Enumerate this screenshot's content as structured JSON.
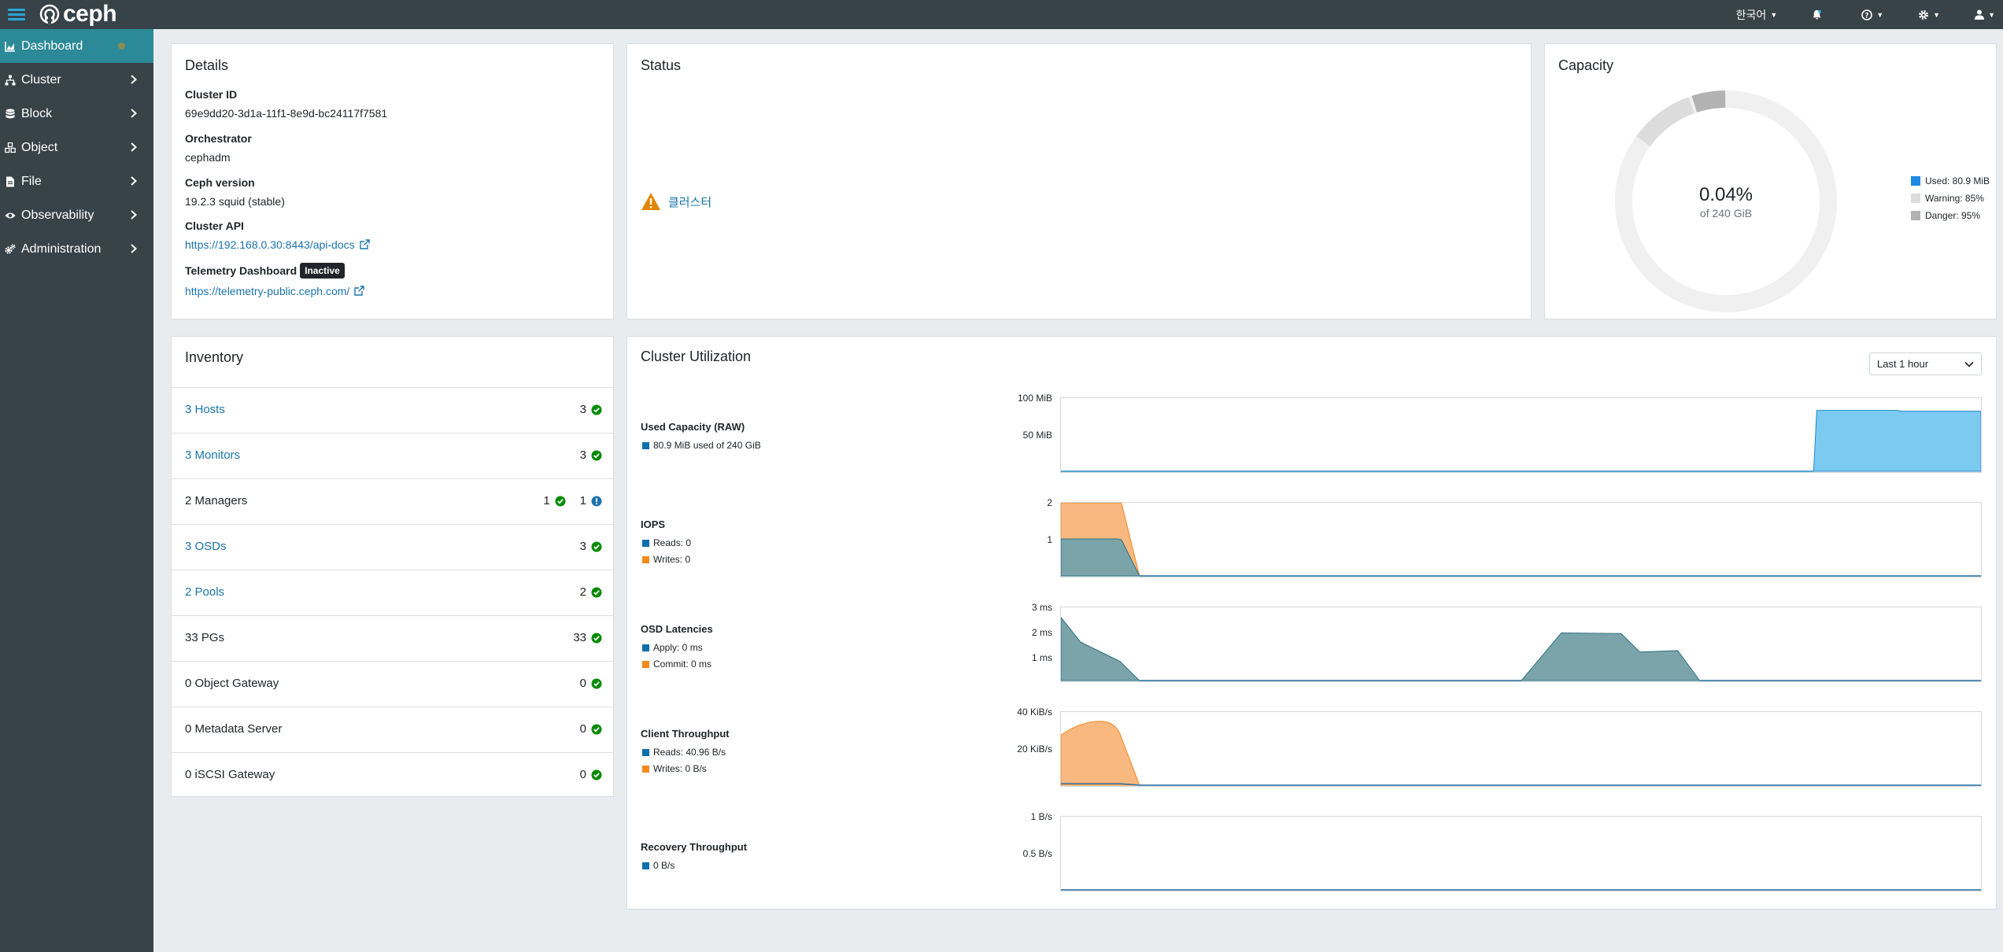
{
  "navbar": {
    "brand": "ceph",
    "language": "한국어",
    "icons": [
      "bell-icon",
      "help-icon",
      "gear-icon",
      "user-icon"
    ]
  },
  "sidebar": {
    "items": [
      {
        "label": "Dashboard",
        "icon": "chart-area-icon",
        "active": true
      },
      {
        "label": "Cluster",
        "icon": "sitemap-icon"
      },
      {
        "label": "Block",
        "icon": "database-icon"
      },
      {
        "label": "Object",
        "icon": "cubes-icon"
      },
      {
        "label": "File",
        "icon": "file-icon"
      },
      {
        "label": "Observability",
        "icon": "eye-icon"
      },
      {
        "label": "Administration",
        "icon": "cogs-icon"
      }
    ]
  },
  "details": {
    "title": "Details",
    "cluster_id_label": "Cluster ID",
    "cluster_id": "69e9dd20-3d1a-11f1-8e9d-bc24117f7581",
    "orchestrator_label": "Orchestrator",
    "orchestrator": "cephadm",
    "version_label": "Ceph version",
    "version": "19.2.3 squid (stable)",
    "api_label": "Cluster API",
    "api_link": "https://192.168.0.30:8443/api-docs",
    "telemetry_label": "Telemetry Dashboard",
    "telemetry_badge": "Inactive",
    "telemetry_link": "https://telemetry-public.ceph.com/"
  },
  "status": {
    "title": "Status",
    "warning_text": "클러스터"
  },
  "capacity": {
    "title": "Capacity",
    "percent": "0.04%",
    "of_total": "of 240 GiB",
    "warning_fraction": 0.85,
    "danger_fraction": 0.95,
    "legend": [
      {
        "label": "Used: 80.9 MiB",
        "color": "#1e88e5"
      },
      {
        "label": "Warning: 85%",
        "color": "#dcdcdc"
      },
      {
        "label": "Danger: 95%",
        "color": "#b2b2b2"
      }
    ]
  },
  "inventory": {
    "title": "Inventory",
    "rows": [
      {
        "label": "3 Hosts",
        "link": true,
        "count": "3",
        "extra": null
      },
      {
        "label": "3 Monitors",
        "link": true,
        "count": "3",
        "extra": null
      },
      {
        "label": "2 Managers",
        "link": false,
        "count": "1",
        "extra": "1"
      },
      {
        "label": "3 OSDs",
        "link": true,
        "count": "3",
        "extra": null
      },
      {
        "label": "2 Pools",
        "link": true,
        "count": "2",
        "extra": null
      },
      {
        "label": "33 PGs",
        "link": false,
        "count": "33",
        "extra": null
      },
      {
        "label": "0 Object Gateway",
        "link": false,
        "count": "0",
        "extra": null
      },
      {
        "label": "0 Metadata Server",
        "link": false,
        "count": "0",
        "extra": null
      },
      {
        "label": "0 iSCSI Gateway",
        "link": false,
        "count": "0",
        "extra": null
      }
    ]
  },
  "utilization": {
    "title": "Cluster Utilization",
    "range": "Last 1 hour",
    "metrics": {
      "used_capacity": {
        "title": "Used Capacity (RAW)",
        "legend": "80.9 MiB used of 240 GiB",
        "ticks": [
          "100 MiB",
          "50 MiB"
        ]
      },
      "iops": {
        "title": "IOPS",
        "reads": "Reads: 0",
        "writes": "Writes: 0",
        "ticks": [
          "2",
          "1"
        ]
      },
      "osd_latencies": {
        "title": "OSD Latencies",
        "apply": "Apply: 0 ms",
        "commit": "Commit: 0 ms",
        "ticks": [
          "3 ms",
          "2 ms",
          "1 ms"
        ]
      },
      "client_throughput": {
        "title": "Client Throughput",
        "reads": "Reads: 40.96 B/s",
        "writes": "Writes: 0 B/s",
        "ticks": [
          "40 KiB/s",
          "20 KiB/s"
        ]
      },
      "recovery_throughput": {
        "title": "Recovery Throughput",
        "legend": "0 B/s",
        "ticks": [
          "1 B/s",
          "0.5 B/s"
        ]
      }
    }
  },
  "colors": {
    "navbar": "#374249",
    "active": "#2c8a98",
    "link": "#1b74ac",
    "read": "#0d6ead",
    "write": "#f28a1e",
    "success": "#008a00",
    "warning": "#e08600"
  }
}
